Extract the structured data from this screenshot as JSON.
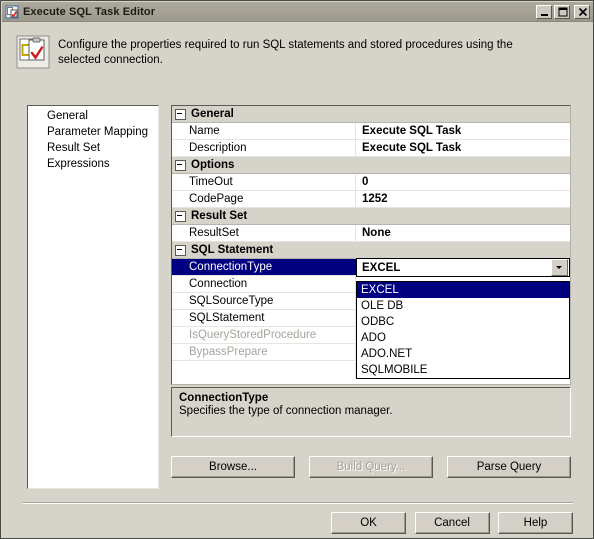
{
  "window": {
    "title": "Execute SQL Task Editor",
    "icon": "execute-sql-task-icon",
    "minimize_label": "_",
    "maximize_label": "□",
    "close_label": "✕"
  },
  "header": {
    "icon": "sql-task-document-icon",
    "description": "Configure the properties required to run SQL statements and stored procedures using the selected connection."
  },
  "pages": {
    "items": [
      {
        "label": "General",
        "selected": true
      },
      {
        "label": "Parameter Mapping",
        "selected": false
      },
      {
        "label": "Result Set",
        "selected": false
      },
      {
        "label": "Expressions",
        "selected": false
      }
    ]
  },
  "grid": {
    "categories": [
      {
        "label": "General",
        "rows": [
          {
            "name": "Name",
            "value": "Execute SQL Task",
            "state": "normal"
          },
          {
            "name": "Description",
            "value": "Execute SQL Task",
            "state": "normal"
          }
        ]
      },
      {
        "label": "Options",
        "rows": [
          {
            "name": "TimeOut",
            "value": "0",
            "state": "normal"
          },
          {
            "name": "CodePage",
            "value": "1252",
            "state": "normal"
          }
        ]
      },
      {
        "label": "Result Set",
        "rows": [
          {
            "name": "ResultSet",
            "value": "None",
            "state": "normal"
          }
        ]
      },
      {
        "label": "SQL Statement",
        "rows": [
          {
            "name": "ConnectionType",
            "value": "EXCEL",
            "state": "selected"
          },
          {
            "name": "Connection",
            "value": "",
            "state": "normal"
          },
          {
            "name": "SQLSourceType",
            "value": "",
            "state": "normal"
          },
          {
            "name": "SQLStatement",
            "value": "",
            "state": "normal"
          },
          {
            "name": "IsQueryStoredProcedure",
            "value": "",
            "state": "disabled"
          },
          {
            "name": "BypassPrepare",
            "value": "",
            "state": "disabled"
          }
        ]
      }
    ]
  },
  "dropdown": {
    "open": true,
    "selected": "EXCEL",
    "options": [
      "EXCEL",
      "OLE DB",
      "ODBC",
      "ADO",
      "ADO.NET",
      "SQLMOBILE"
    ]
  },
  "description_panel": {
    "title": "ConnectionType",
    "body": "Specifies the type of connection manager."
  },
  "actions": {
    "browse": "Browse...",
    "build_query": "Build Query...",
    "parse_query": "Parse Query"
  },
  "footer": {
    "ok": "OK",
    "cancel": "Cancel",
    "help": "Help"
  },
  "colors": {
    "dialog_face": "#d6d3ca",
    "selection": "#000080",
    "button_face": "#d4d0c8",
    "disabled_text": "#a7a39b"
  }
}
